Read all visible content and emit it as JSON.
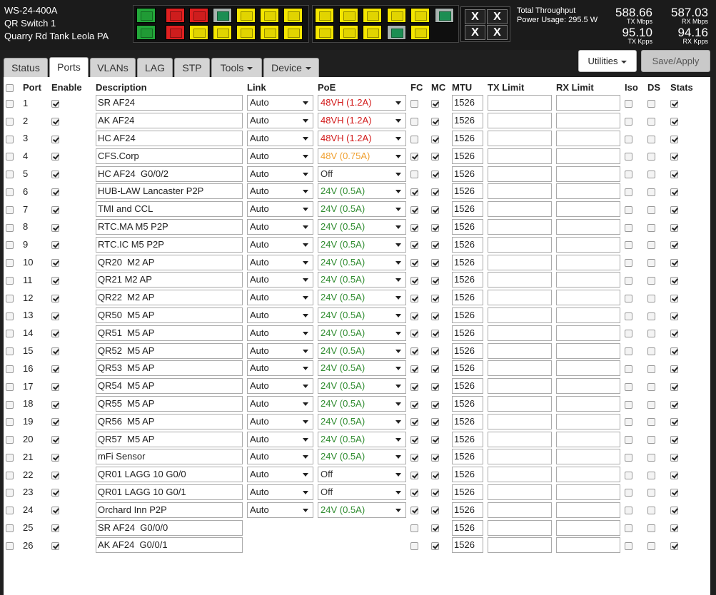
{
  "device": {
    "model": "WS-24-400A",
    "name": "QR Switch 1",
    "location": "Quarry Rd Tank Leola PA"
  },
  "throughput": {
    "title": "Total Throughput",
    "power": "Power Usage: 295.5 W",
    "tx_mbps": "588.66",
    "tx_mbps_label": "TX Mbps",
    "rx_mbps": "587.03",
    "rx_mbps_label": "RX Mbps",
    "tx_kpps": "95.10",
    "tx_kpps_label": "TX Kpps",
    "rx_kpps": "94.16",
    "rx_kpps_label": "RX Kpps"
  },
  "port_panel": {
    "top": [
      "green",
      "red",
      "red",
      "gray",
      "yellow",
      "yellow",
      "yellow",
      "yellow",
      "yellow",
      "yellow",
      "yellow",
      "yellow",
      "gray"
    ],
    "bottom": [
      "green",
      "red",
      "yellow",
      "yellow",
      "yellow",
      "yellow",
      "yellow",
      "yellow",
      "yellow",
      "yellow",
      "gray",
      "yellow"
    ]
  },
  "x_buttons": [
    "X",
    "X",
    "X",
    "X"
  ],
  "tabs": [
    {
      "label": "Status"
    },
    {
      "label": "Ports",
      "active": true
    },
    {
      "label": "VLANs"
    },
    {
      "label": "LAG"
    },
    {
      "label": "STP"
    },
    {
      "label": "Tools",
      "dropdown": true
    },
    {
      "label": "Device",
      "dropdown": true
    }
  ],
  "actions": {
    "utilities": "Utilities",
    "save": "Save/Apply"
  },
  "columns": [
    "Port",
    "Enable",
    "Description",
    "Link",
    "PoE",
    "FC",
    "MC",
    "MTU",
    "TX Limit",
    "RX Limit",
    "Iso",
    "DS",
    "Stats"
  ],
  "colors": {
    "poe_red": "#d21b1b",
    "poe_orange": "#f0a030",
    "poe_green": "#2e8b2e"
  },
  "ports": [
    {
      "port": "1",
      "enable": true,
      "desc": "SR AF24",
      "link": "Auto",
      "poe": "48VH (1.2A)",
      "poe_color": "red",
      "fc": false,
      "mc": true,
      "mtu": "1526",
      "iso": false,
      "ds": false,
      "stats": true
    },
    {
      "port": "2",
      "enable": true,
      "desc": "AK AF24",
      "link": "Auto",
      "poe": "48VH (1.2A)",
      "poe_color": "red",
      "fc": false,
      "mc": true,
      "mtu": "1526",
      "iso": false,
      "ds": false,
      "stats": true
    },
    {
      "port": "3",
      "enable": true,
      "desc": "HC AF24",
      "link": "Auto",
      "poe": "48VH (1.2A)",
      "poe_color": "red",
      "fc": false,
      "mc": true,
      "mtu": "1526",
      "iso": false,
      "ds": false,
      "stats": true
    },
    {
      "port": "4",
      "enable": true,
      "desc": "CFS.Corp",
      "link": "Auto",
      "poe": "48V (0.75A)",
      "poe_color": "orange",
      "fc": true,
      "mc": true,
      "mtu": "1526",
      "iso": false,
      "ds": false,
      "stats": true
    },
    {
      "port": "5",
      "enable": true,
      "desc": "HC AF24  G0/0/2",
      "link": "Auto",
      "poe": "Off",
      "poe_color": "off",
      "fc": false,
      "mc": true,
      "mtu": "1526",
      "iso": false,
      "ds": false,
      "stats": true
    },
    {
      "port": "6",
      "enable": true,
      "desc": "HUB-LAW Lancaster P2P",
      "link": "Auto",
      "poe": "24V (0.5A)",
      "poe_color": "green",
      "fc": true,
      "mc": true,
      "mtu": "1526",
      "iso": false,
      "ds": false,
      "stats": true
    },
    {
      "port": "7",
      "enable": true,
      "desc": "TMI and CCL",
      "link": "Auto",
      "poe": "24V (0.5A)",
      "poe_color": "green",
      "fc": true,
      "mc": true,
      "mtu": "1526",
      "iso": false,
      "ds": false,
      "stats": true
    },
    {
      "port": "8",
      "enable": true,
      "desc": "RTC.MA M5 P2P",
      "link": "Auto",
      "poe": "24V (0.5A)",
      "poe_color": "green",
      "fc": true,
      "mc": true,
      "mtu": "1526",
      "iso": false,
      "ds": false,
      "stats": true
    },
    {
      "port": "9",
      "enable": true,
      "desc": "RTC.IC M5 P2P",
      "link": "Auto",
      "poe": "24V (0.5A)",
      "poe_color": "green",
      "fc": true,
      "mc": true,
      "mtu": "1526",
      "iso": false,
      "ds": false,
      "stats": true
    },
    {
      "port": "10",
      "enable": true,
      "desc": "QR20  M2 AP",
      "link": "Auto",
      "poe": "24V (0.5A)",
      "poe_color": "green",
      "fc": true,
      "mc": true,
      "mtu": "1526",
      "iso": false,
      "ds": false,
      "stats": true
    },
    {
      "port": "11",
      "enable": true,
      "desc": "QR21 M2 AP",
      "link": "Auto",
      "poe": "24V (0.5A)",
      "poe_color": "green",
      "fc": true,
      "mc": true,
      "mtu": "1526",
      "iso": false,
      "ds": false,
      "stats": true
    },
    {
      "port": "12",
      "enable": true,
      "desc": "QR22  M2 AP",
      "link": "Auto",
      "poe": "24V (0.5A)",
      "poe_color": "green",
      "fc": true,
      "mc": true,
      "mtu": "1526",
      "iso": false,
      "ds": false,
      "stats": true
    },
    {
      "port": "13",
      "enable": true,
      "desc": "QR50  M5 AP",
      "link": "Auto",
      "poe": "24V (0.5A)",
      "poe_color": "green",
      "fc": true,
      "mc": true,
      "mtu": "1526",
      "iso": false,
      "ds": false,
      "stats": true
    },
    {
      "port": "14",
      "enable": true,
      "desc": "QR51  M5 AP",
      "link": "Auto",
      "poe": "24V (0.5A)",
      "poe_color": "green",
      "fc": true,
      "mc": true,
      "mtu": "1526",
      "iso": false,
      "ds": false,
      "stats": true
    },
    {
      "port": "15",
      "enable": true,
      "desc": "QR52  M5 AP",
      "link": "Auto",
      "poe": "24V (0.5A)",
      "poe_color": "green",
      "fc": true,
      "mc": true,
      "mtu": "1526",
      "iso": false,
      "ds": false,
      "stats": true
    },
    {
      "port": "16",
      "enable": true,
      "desc": "QR53  M5 AP",
      "link": "Auto",
      "poe": "24V (0.5A)",
      "poe_color": "green",
      "fc": true,
      "mc": true,
      "mtu": "1526",
      "iso": false,
      "ds": false,
      "stats": true
    },
    {
      "port": "17",
      "enable": true,
      "desc": "QR54  M5 AP",
      "link": "Auto",
      "poe": "24V (0.5A)",
      "poe_color": "green",
      "fc": true,
      "mc": true,
      "mtu": "1526",
      "iso": false,
      "ds": false,
      "stats": true
    },
    {
      "port": "18",
      "enable": true,
      "desc": "QR55  M5 AP",
      "link": "Auto",
      "poe": "24V (0.5A)",
      "poe_color": "green",
      "fc": true,
      "mc": true,
      "mtu": "1526",
      "iso": false,
      "ds": false,
      "stats": true
    },
    {
      "port": "19",
      "enable": true,
      "desc": "QR56  M5 AP",
      "link": "Auto",
      "poe": "24V (0.5A)",
      "poe_color": "green",
      "fc": true,
      "mc": true,
      "mtu": "1526",
      "iso": false,
      "ds": false,
      "stats": true
    },
    {
      "port": "20",
      "enable": true,
      "desc": "QR57  M5 AP",
      "link": "Auto",
      "poe": "24V (0.5A)",
      "poe_color": "green",
      "fc": true,
      "mc": true,
      "mtu": "1526",
      "iso": false,
      "ds": false,
      "stats": true
    },
    {
      "port": "21",
      "enable": true,
      "desc": "mFi Sensor",
      "link": "Auto",
      "poe": "24V (0.5A)",
      "poe_color": "green",
      "fc": true,
      "mc": true,
      "mtu": "1526",
      "iso": false,
      "ds": false,
      "stats": true
    },
    {
      "port": "22",
      "enable": true,
      "desc": "QR01 LAGG 10 G0/0",
      "link": "Auto",
      "poe": "Off",
      "poe_color": "off",
      "fc": true,
      "mc": true,
      "mtu": "1526",
      "iso": false,
      "ds": false,
      "stats": true
    },
    {
      "port": "23",
      "enable": true,
      "desc": "QR01 LAGG 10 G0/1",
      "link": "Auto",
      "poe": "Off",
      "poe_color": "off",
      "fc": true,
      "mc": true,
      "mtu": "1526",
      "iso": false,
      "ds": false,
      "stats": true
    },
    {
      "port": "24",
      "enable": true,
      "desc": "Orchard Inn P2P",
      "link": "Auto",
      "poe": "24V (0.5A)",
      "poe_color": "green",
      "fc": true,
      "mc": true,
      "mtu": "1526",
      "iso": false,
      "ds": false,
      "stats": true
    },
    {
      "port": "25",
      "enable": true,
      "desc": "SR AF24  G0/0/0",
      "link": "",
      "poe": "",
      "poe_color": "",
      "fc": false,
      "mc": true,
      "mtu": "1526",
      "iso": false,
      "ds": false,
      "stats": true
    },
    {
      "port": "26",
      "enable": true,
      "desc": "AK AF24  G0/0/1",
      "link": "",
      "poe": "",
      "poe_color": "",
      "fc": false,
      "mc": true,
      "mtu": "1526",
      "iso": false,
      "ds": false,
      "stats": true
    }
  ]
}
